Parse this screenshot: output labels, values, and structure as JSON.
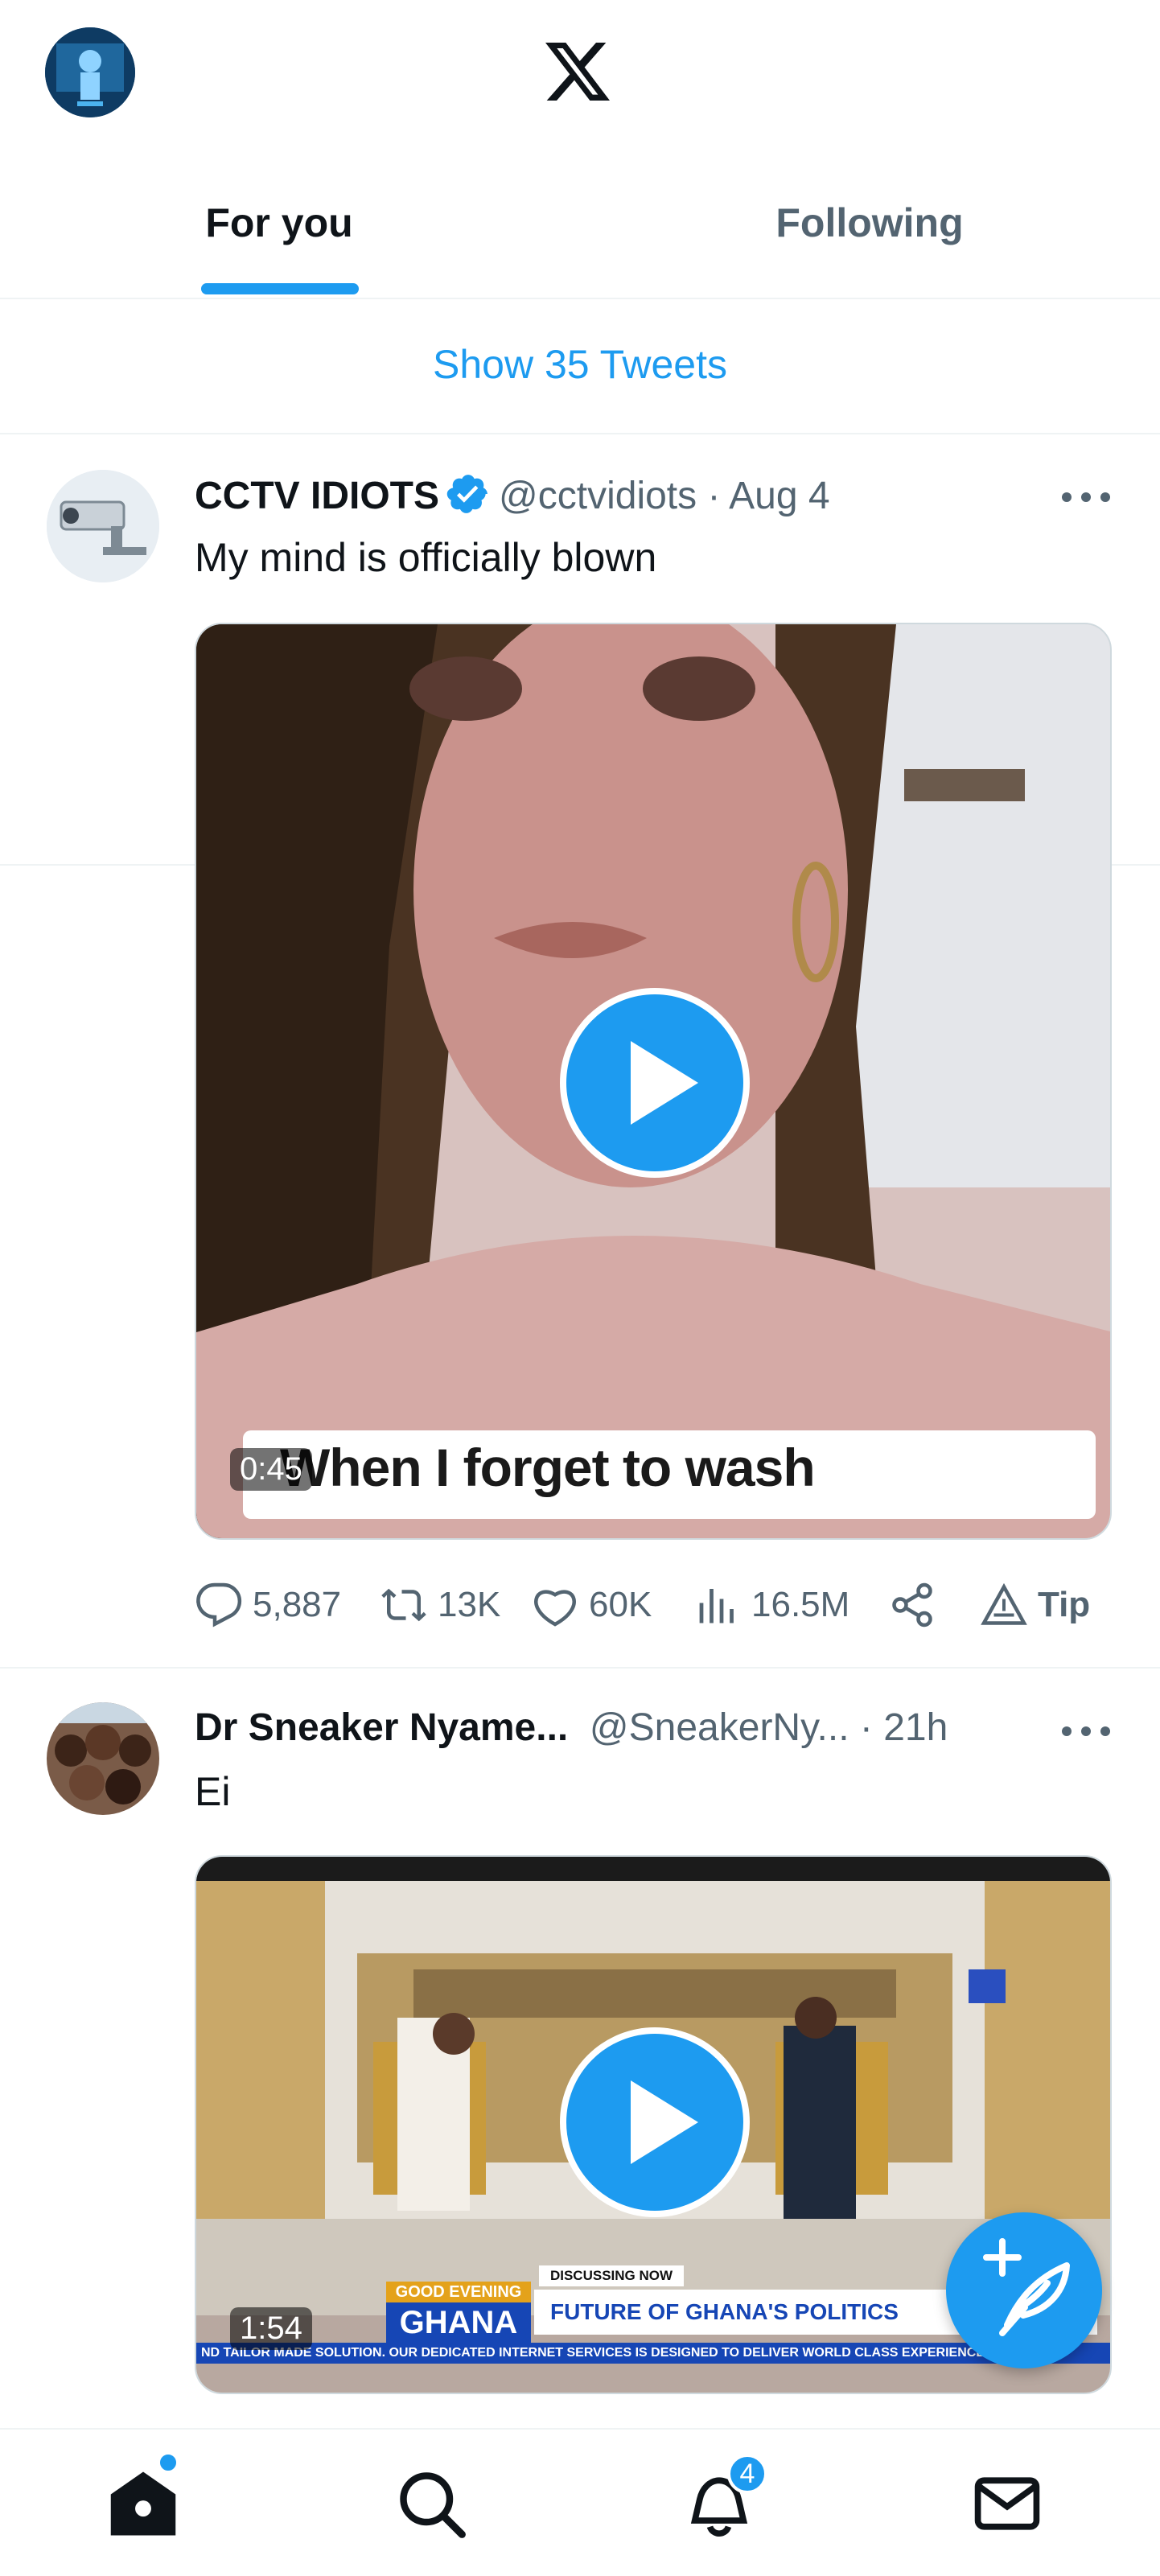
{
  "header": {
    "tabs": [
      {
        "label": "For you",
        "active": true
      },
      {
        "label": "Following",
        "active": false
      }
    ],
    "logo_icon": "x-logo-icon"
  },
  "show_tweets": {
    "label": "Show 35 Tweets"
  },
  "tweets": [
    {
      "name": "CCTV IDIOTS",
      "verified": true,
      "handle": "@cctvidiots",
      "time": "· Aug 4",
      "text": "My mind is officially blown",
      "video_duration": "0:45",
      "video_caption": "When I forget to wash",
      "stats": {
        "replies": "5,887",
        "retweets": "13K",
        "likes": "60K",
        "views": "16.5M",
        "tip": "Tip"
      }
    },
    {
      "name": "Dr Sneaker Nyame...",
      "verified": false,
      "handle": "@SneakerNy...",
      "time": "· 21h",
      "text": "Ei",
      "video_duration": "1:54",
      "banner": {
        "discussing": "DISCUSSING NOW",
        "show": "GOOD EVENING",
        "country": "GHANA",
        "headline": "FUTURE OF GHANA'S POLITICS",
        "ticker": "ND TAILOR MADE SOLUTION. OUR DEDICATED INTERNET SERVICES IS DESIGNED TO DELIVER WORLD CLASS EXPERIENCE"
      }
    }
  ],
  "nav": {
    "notifications_count": "4",
    "items": [
      "home-icon",
      "search-icon",
      "notifications-icon",
      "messages-icon"
    ]
  },
  "colors": {
    "accent": "#1d9bf0",
    "text": "#0f1419",
    "muted": "#536471",
    "border": "#eff3f4"
  }
}
